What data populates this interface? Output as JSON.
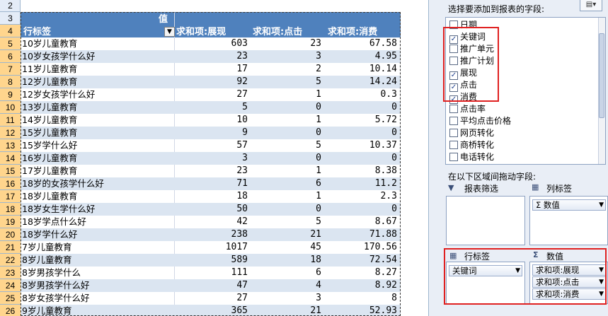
{
  "sheet": {
    "row_numbers": [
      "2",
      "3",
      "4",
      "5",
      "6",
      "7",
      "8",
      "9",
      "10",
      "11",
      "12",
      "13",
      "14",
      "15",
      "16",
      "17",
      "18",
      "19",
      "20",
      "21",
      "22",
      "23",
      "24",
      "25",
      "26"
    ],
    "header": {
      "values_label": "值",
      "row_label": "行标签",
      "col1": "求和项:展现",
      "col2": "求和项:点击",
      "col3": "求和项:消费",
      "filter_icon": "▼"
    },
    "rows": [
      {
        "label": "10岁儿童教育",
        "v1": "603",
        "v2": "23",
        "v3": "67.58"
      },
      {
        "label": "10岁女孩学什么好",
        "v1": "23",
        "v2": "3",
        "v3": "4.95"
      },
      {
        "label": "11岁儿童教育",
        "v1": "17",
        "v2": "2",
        "v3": "10.14"
      },
      {
        "label": "12岁儿童教育",
        "v1": "92",
        "v2": "5",
        "v3": "14.24"
      },
      {
        "label": "12岁女孩学什么好",
        "v1": "27",
        "v2": "1",
        "v3": "0.3"
      },
      {
        "label": "13岁儿童教育",
        "v1": "5",
        "v2": "0",
        "v3": "0"
      },
      {
        "label": "14岁儿童教育",
        "v1": "10",
        "v2": "1",
        "v3": "5.72"
      },
      {
        "label": "15岁儿童教育",
        "v1": "9",
        "v2": "0",
        "v3": "0"
      },
      {
        "label": "15岁学什么好",
        "v1": "57",
        "v2": "5",
        "v3": "10.37"
      },
      {
        "label": "16岁儿童教育",
        "v1": "3",
        "v2": "0",
        "v3": "0"
      },
      {
        "label": "17岁儿童教育",
        "v1": "23",
        "v2": "1",
        "v3": "8.38"
      },
      {
        "label": "18岁的女孩学什么好",
        "v1": "71",
        "v2": "6",
        "v3": "11.2"
      },
      {
        "label": "18岁儿童教育",
        "v1": "18",
        "v2": "1",
        "v3": "2.3"
      },
      {
        "label": "18岁女生学什么好",
        "v1": "50",
        "v2": "0",
        "v3": "0"
      },
      {
        "label": "18岁学点什么好",
        "v1": "42",
        "v2": "5",
        "v3": "8.67"
      },
      {
        "label": "18岁学什么好",
        "v1": "238",
        "v2": "21",
        "v3": "71.88"
      },
      {
        "label": "7岁儿童教育",
        "v1": "1017",
        "v2": "45",
        "v3": "170.56"
      },
      {
        "label": "8岁儿童教育",
        "v1": "589",
        "v2": "18",
        "v3": "72.54"
      },
      {
        "label": "8岁男孩学什么",
        "v1": "111",
        "v2": "6",
        "v3": "8.27"
      },
      {
        "label": "8岁男孩学什么好",
        "v1": "47",
        "v2": "4",
        "v3": "8.92"
      },
      {
        "label": "8岁女孩学什么好",
        "v1": "27",
        "v2": "3",
        "v3": "8"
      },
      {
        "label": "9岁儿童教育",
        "v1": "365",
        "v2": "21",
        "v3": "52.93"
      }
    ]
  },
  "fieldpane": {
    "title": "选择要添加到报表的字段:",
    "layout_button": "▤▾",
    "fields": [
      {
        "label": "日期",
        "checked": false
      },
      {
        "label": "关键词",
        "checked": true
      },
      {
        "label": "推广单元",
        "checked": false
      },
      {
        "label": "推广计划",
        "checked": false
      },
      {
        "label": "展现",
        "checked": true
      },
      {
        "label": "点击",
        "checked": true
      },
      {
        "label": "消费",
        "checked": true
      },
      {
        "label": "点击率",
        "checked": false
      },
      {
        "label": "平均点击价格",
        "checked": false
      },
      {
        "label": "网页转化",
        "checked": false
      },
      {
        "label": "商桥转化",
        "checked": false
      },
      {
        "label": "电话转化",
        "checked": false
      }
    ],
    "check_mark": "✓",
    "areas_title": "在以下区域间拖动字段:",
    "report_filter": {
      "label": "报表筛选",
      "icon": "funnel-icon"
    },
    "column_labels": {
      "label": "列标签",
      "icon": "grid-icon",
      "items": [
        "Σ 数值"
      ]
    },
    "row_labels": {
      "label": "行标签",
      "icon": "grid-icon",
      "items": [
        "关键词"
      ]
    },
    "values": {
      "label": "数值",
      "icon": "sigma-icon",
      "items": [
        "求和项:展现",
        "求和项:点击",
        "求和项:消费"
      ]
    },
    "sigma_glyph": "Σ",
    "funnel_glyph": "▼",
    "grid_glyph": "▦",
    "dropdown_glyph": "▼"
  },
  "colors": {
    "header_blue": "#4f81bd",
    "band_blue": "#dbe5f1",
    "highlight_red": "#e02020"
  }
}
